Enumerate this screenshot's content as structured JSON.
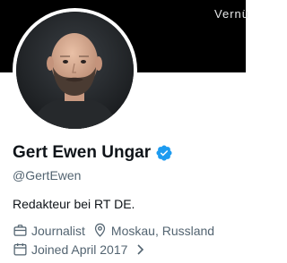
{
  "header": {
    "banner_color": "#000000",
    "edit_label": "Vernü"
  },
  "profile": {
    "avatar_icon": "profile-photo",
    "display_name": "Gert Ewen Ungar",
    "verified_icon": "verified-badge-icon",
    "verified_color": "#1d9bf0",
    "handle": "@GertEwen",
    "bio": "Redakteur bei RT DE.",
    "profession": "Journalist",
    "profession_icon": "briefcase-icon",
    "location": "Moskau, Russland",
    "location_icon": "location-pin-icon",
    "joined": "Joined April 2017",
    "joined_icon": "calendar-icon",
    "joined_chevron_icon": "chevron-right-icon"
  },
  "colors": {
    "text_primary": "#0f1419",
    "text_secondary": "#536471"
  }
}
